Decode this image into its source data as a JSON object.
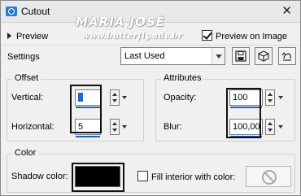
{
  "window": {
    "title": "Cutout",
    "close_symbol": "✕"
  },
  "watermark": {
    "name": "MARIA JOSÉ",
    "url": "www.butterfly.adv.br"
  },
  "preview": {
    "label": "Preview",
    "preview_on_image_label": "Preview on Image",
    "preview_on_image_checked": true
  },
  "settings": {
    "label": "Settings",
    "selected": "Last Used"
  },
  "toolbar": {
    "save_icon": "save-icon",
    "presets_icon": "presets-icon",
    "reset_icon": "reset-icon"
  },
  "offset": {
    "legend": "Offset",
    "vertical_label": "Vertical:",
    "vertical_value": "5",
    "horizontal_label": "Horizontal:",
    "horizontal_value": "5"
  },
  "attributes": {
    "legend": "Attributes",
    "opacity_label": "Opacity:",
    "opacity_value": "100",
    "blur_label": "Blur:",
    "blur_value": "100,00"
  },
  "color": {
    "legend": "Color",
    "shadow_label": "Shadow color:",
    "shadow_color": "#000000",
    "fill_interior_label": "Fill interior with color:",
    "fill_interior_checked": false
  }
}
